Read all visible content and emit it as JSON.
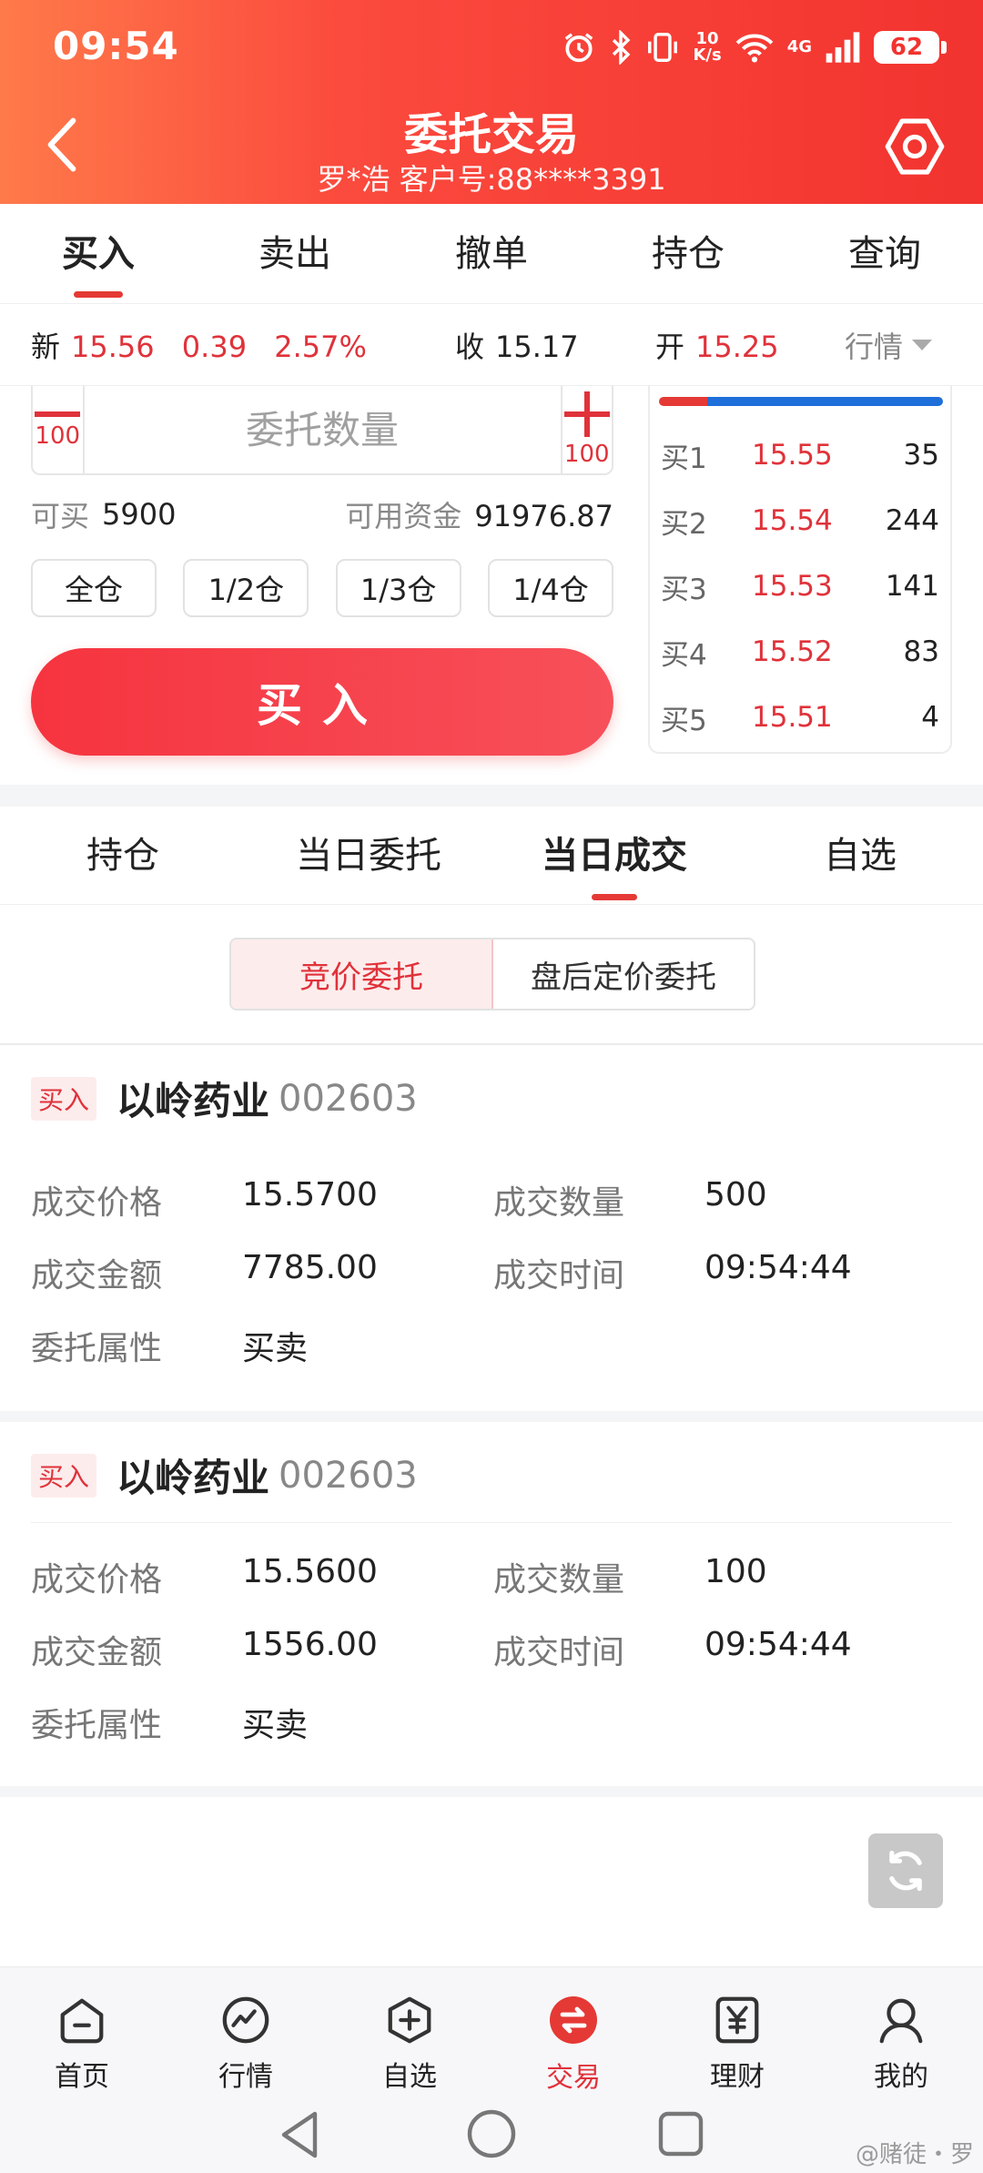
{
  "status_bar": {
    "time": "09:54",
    "net_speed_top": "10",
    "net_speed_bottom": "K/s",
    "signal_label": "4G",
    "battery": "62"
  },
  "header": {
    "title": "委托交易",
    "subtitle": "罗*浩 客户号:88****3391"
  },
  "main_tabs": [
    {
      "label": "买入",
      "active": true
    },
    {
      "label": "卖出",
      "active": false
    },
    {
      "label": "撤单",
      "active": false
    },
    {
      "label": "持仓",
      "active": false
    },
    {
      "label": "查询",
      "active": false
    }
  ],
  "quote": {
    "new_label": "新",
    "new_price": "15.56",
    "change": "0.39",
    "change_pct": "2.57%",
    "close_label": "收",
    "close_price": "15.17",
    "open_label": "开",
    "open_price": "15.25",
    "market_label": "行情"
  },
  "order_form": {
    "minus_step": "100",
    "plus_step": "100",
    "qty_placeholder": "委托数量",
    "qty_value": "",
    "can_buy_label": "可买",
    "can_buy_value": "5900",
    "fund_label": "可用资金",
    "fund_value": "91976.87",
    "position_buttons": [
      "全仓",
      "1/2仓",
      "1/3仓",
      "1/4仓"
    ],
    "buy_button": "买入"
  },
  "order_book": {
    "buy_ratio": 0.17,
    "rows": [
      {
        "level": "买1",
        "price": "15.55",
        "volume": "35"
      },
      {
        "level": "买2",
        "price": "15.54",
        "volume": "244"
      },
      {
        "level": "买3",
        "price": "15.53",
        "volume": "141"
      },
      {
        "level": "买4",
        "price": "15.52",
        "volume": "83"
      },
      {
        "level": "买5",
        "price": "15.51",
        "volume": "4"
      }
    ]
  },
  "sub_tabs": [
    {
      "label": "持仓",
      "active": false
    },
    {
      "label": "当日委托",
      "active": false
    },
    {
      "label": "当日成交",
      "active": true
    },
    {
      "label": "自选",
      "active": false
    }
  ],
  "segments": [
    {
      "label": "竞价委托",
      "active": true
    },
    {
      "label": "盘后定价委托",
      "active": false
    }
  ],
  "trades": [
    {
      "side": "买入",
      "name": "以岭药业",
      "code": "002603",
      "price_label": "成交价格",
      "price": "15.5700",
      "qty_label": "成交数量",
      "qty": "500",
      "amount_label": "成交金额",
      "amount": "7785.00",
      "time_label": "成交时间",
      "time": "09:54:44",
      "attr_label": "委托属性",
      "attr": "买卖"
    },
    {
      "side": "买入",
      "name": "以岭药业",
      "code": "002603",
      "price_label": "成交价格",
      "price": "15.5600",
      "qty_label": "成交数量",
      "qty": "100",
      "amount_label": "成交金额",
      "amount": "1556.00",
      "time_label": "成交时间",
      "time": "09:54:44",
      "attr_label": "委托属性",
      "attr": "买卖"
    }
  ],
  "bottom_nav": [
    {
      "label": "首页",
      "icon": "home-icon",
      "active": false
    },
    {
      "label": "行情",
      "icon": "market-icon",
      "active": false
    },
    {
      "label": "自选",
      "icon": "watchlist-icon",
      "active": false
    },
    {
      "label": "交易",
      "icon": "trade-icon",
      "active": true
    },
    {
      "label": "理财",
      "icon": "finance-icon",
      "active": false
    },
    {
      "label": "我的",
      "icon": "profile-icon",
      "active": false
    }
  ],
  "watermark": "@赌徒・罗",
  "colors": {
    "accent": "#e0323a",
    "header_start": "#ff7a4a",
    "header_end": "#f2332f",
    "book_buy": "#e53935",
    "book_sell": "#1e6fd9"
  }
}
